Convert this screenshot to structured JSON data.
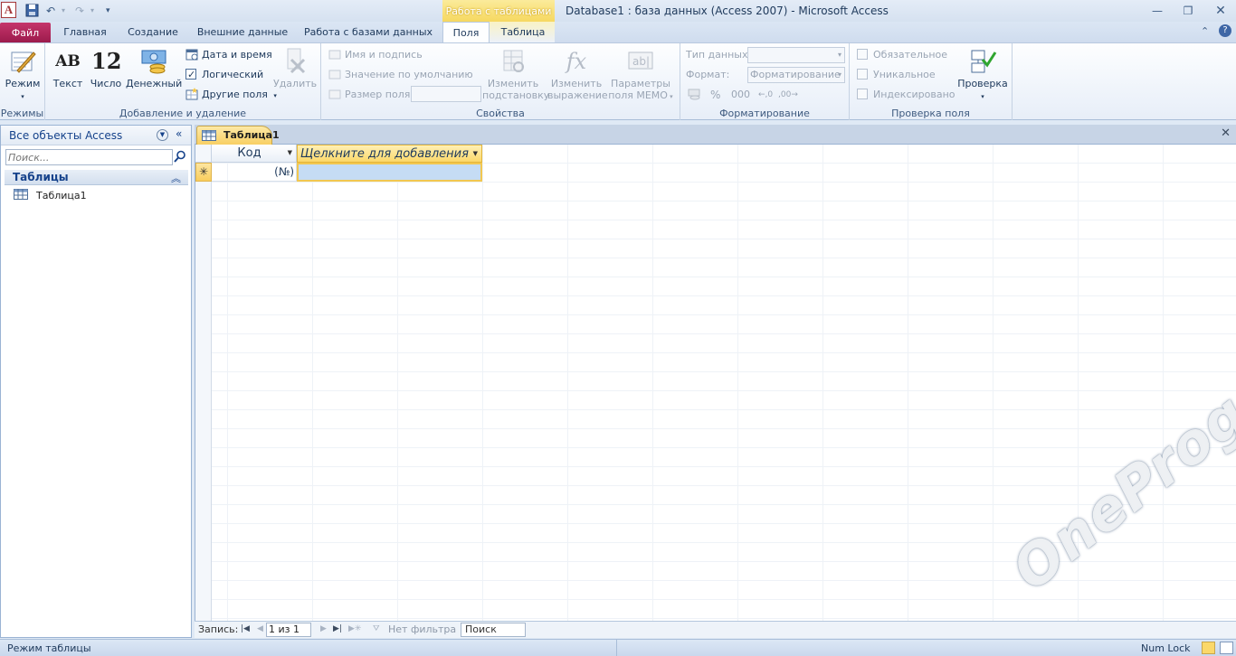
{
  "titlebar": {
    "app_icon": "A",
    "context_header": "Работа с таблицами",
    "title": "Database1 : база данных (Access 2007)  -  Microsoft Access"
  },
  "tabs": [
    {
      "label": "Файл"
    },
    {
      "label": "Главная"
    },
    {
      "label": "Создание"
    },
    {
      "label": "Внешние данные"
    },
    {
      "label": "Работа с базами данных"
    },
    {
      "label": "Поля"
    },
    {
      "label": "Таблица"
    }
  ],
  "ribbon": {
    "modes": {
      "label": "Режимы",
      "view_btn": "Режим"
    },
    "add_delete": {
      "label": "Добавление и удаление",
      "text_btn": "Текст",
      "number_btn": "Число",
      "currency_btn": "Денежный",
      "datetime_btn": "Дата и время",
      "logical_btn": "Логический",
      "other_fields_btn": "Другие поля",
      "delete_btn": "Удалить",
      "icon_ab": "AB",
      "icon_12": "12"
    },
    "properties": {
      "label": "Свойства",
      "name_caption_btn": "Имя и подпись",
      "default_value_btn": "Значение по умолчанию",
      "field_size_btn": "Размер поля",
      "modify_lookups_line1": "Изменить",
      "modify_lookups_line2": "подстановку",
      "modify_expression_line1": "Изменить",
      "modify_expression_line2": "выражение",
      "memo_settings_line1": "Параметры",
      "memo_settings_line2": "поля МЕМО"
    },
    "formatting": {
      "label": "Форматирование",
      "data_type_label": "Тип данных:",
      "format_label": "Формат:",
      "format_value": "Форматирование",
      "percent_symbol": "%",
      "thousands_symbol": "000"
    },
    "validation": {
      "label": "Проверка поля",
      "required": "Обязательное",
      "unique": "Уникальное",
      "indexed": "Индексировано",
      "validation_btn": "Проверка"
    }
  },
  "navpane": {
    "title": "Все объекты Access",
    "search_placeholder": "Поиск...",
    "group_label": "Таблицы",
    "items": [
      {
        "label": "Таблица1"
      }
    ]
  },
  "document": {
    "tab_label": "Таблица1",
    "columns": [
      {
        "label": "Код"
      },
      {
        "label": "Щелкните для добавления"
      }
    ],
    "new_row_marker": "✳",
    "new_row_value": "(№)"
  },
  "record_nav": {
    "label": "Запись:",
    "position": "1 из 1",
    "filter_label": "Нет фильтра",
    "search_label": "Поиск"
  },
  "statusbar": {
    "mode": "Режим таблицы",
    "numlock": "Num Lock"
  },
  "watermark": "OneProgs.ru"
}
